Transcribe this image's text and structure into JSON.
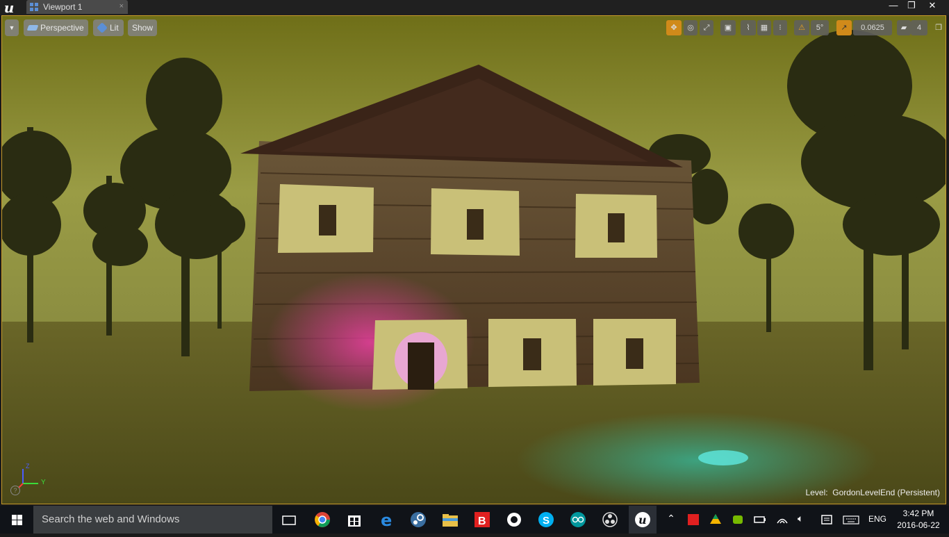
{
  "window": {
    "tab_label": "Viewport 1",
    "tab_close": "×",
    "minimize": "—",
    "maximize": "❐",
    "close": "✕"
  },
  "viewport": {
    "options_arrow": "▼",
    "view_mode": "Perspective",
    "lighting_mode": "Lit",
    "show_label": "Show",
    "rotation_snap": "5°",
    "scale_snap": "0.0625",
    "camera_speed": "4",
    "axis_y": "Y",
    "axis_z": "Z",
    "level_prefix": "Level:",
    "level_name": "GordonLevelEnd (Persistent)"
  },
  "taskbar": {
    "search_placeholder": "Search the web and Windows",
    "language": "ENG",
    "time": "3:42 PM",
    "date": "2016-06-22",
    "pinned": [
      "task-view",
      "chrome",
      "store",
      "edge",
      "steam",
      "file-explorer",
      "bitdefender",
      "blender",
      "skype",
      "arduino",
      "obs",
      "unreal-engine"
    ]
  },
  "colors": {
    "accent": "#c89a2a",
    "sky": "#8f9436",
    "ground": "#5e5a22",
    "wall": "#5a4227",
    "roof": "#3a2418",
    "panel": "#c9c078",
    "glow_pink": "#ff3aa0",
    "glow_cyan": "#2fd8c0"
  }
}
